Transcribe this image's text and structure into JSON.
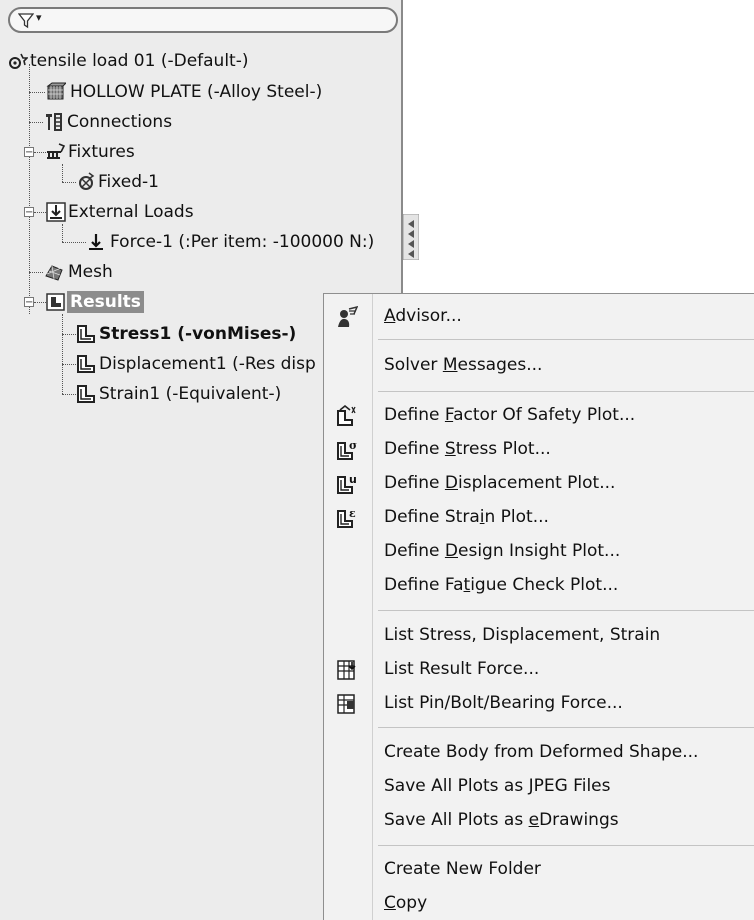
{
  "tree": {
    "filter_arrow": "▾",
    "root": {
      "label": "tensile load 01 (-Default-)",
      "icon": "study-icon"
    },
    "part": {
      "label": "HOLLOW PLATE (-Alloy Steel-)",
      "icon": "solid-body-icon"
    },
    "connections": {
      "label": "Connections",
      "icon": "connections-icon"
    },
    "fixtures": {
      "label": "Fixtures",
      "icon": "fixtures-icon",
      "expander": "−"
    },
    "fixed1": {
      "label": "Fixed-1",
      "icon": "fixed-geometry-icon"
    },
    "external_loads": {
      "label": "External Loads",
      "icon": "external-loads-icon",
      "expander": "−"
    },
    "force1": {
      "label": "Force-1 (:Per item: -100000 N:)",
      "icon": "force-arrow-icon"
    },
    "mesh": {
      "label": "Mesh",
      "icon": "mesh-icon"
    },
    "results": {
      "label": "Results",
      "icon": "results-folder-icon",
      "expander": "−"
    },
    "stress1": {
      "label": "Stress1 (-vonMises-)",
      "icon": "plot-icon"
    },
    "displacement1": {
      "label": "Displacement1 (-Res disp",
      "icon": "plot-icon"
    },
    "strain1": {
      "label": "Strain1 (-Equivalent-)",
      "icon": "plot-icon"
    }
  },
  "context_menu": {
    "advisor": {
      "pre": "",
      "u": "A",
      "post": "dvisor...",
      "icon": "advisor-icon"
    },
    "solver_messages": {
      "pre": "Solver ",
      "u": "M",
      "post": "essages..."
    },
    "define_fos": {
      "pre": "Define ",
      "u": "F",
      "post": "actor Of Safety Plot...",
      "icon": "factor-of-safety-plot-icon"
    },
    "define_stress": {
      "pre": "Define ",
      "u": "S",
      "post": "tress Plot...",
      "icon": "stress-plot-icon",
      "icon_letter": "σ"
    },
    "define_displacement": {
      "pre": "Define ",
      "u": "D",
      "post": "isplacement Plot...",
      "icon": "displacement-plot-icon",
      "icon_letter": "u"
    },
    "define_strain": {
      "pre": "Define Stra",
      "u": "i",
      "post": "n Plot...",
      "icon": "strain-plot-icon",
      "icon_letter": "ε"
    },
    "define_design_insight": {
      "pre": "Define ",
      "u": "D",
      "post": "esign Insight Plot..."
    },
    "define_fatigue": {
      "pre": "Define Fa",
      "u": "t",
      "post": "igue Check Plot..."
    },
    "list_sds": {
      "label": "List Stress, Displacement, Strain"
    },
    "list_result_force": {
      "label": "List Result Force...",
      "icon": "list-result-force-icon"
    },
    "list_pin_bolt": {
      "label": "List Pin/Bolt/Bearing Force...",
      "icon": "list-pin-bolt-force-icon"
    },
    "create_body": {
      "label": "Create Body from Deformed Shape..."
    },
    "save_jpeg": {
      "pre": "Save All Plots as ",
      "u": "J",
      "post": "PEG Files"
    },
    "save_edrawings": {
      "pre": "Save All Plots as ",
      "u": "e",
      "post": "Drawings"
    },
    "create_folder": {
      "label": "Create New Folder"
    },
    "copy": {
      "pre": "",
      "u": "C",
      "post": "opy"
    }
  }
}
